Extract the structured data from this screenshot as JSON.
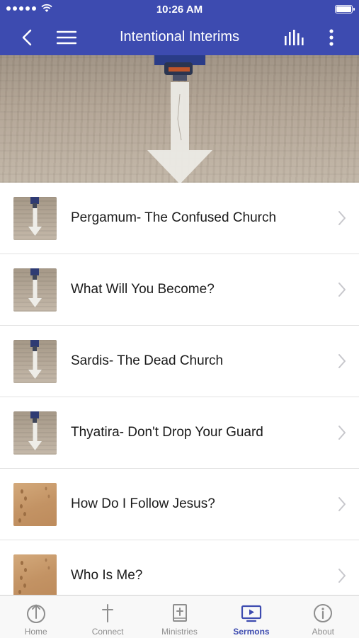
{
  "status_bar": {
    "time": "10:26 AM"
  },
  "header": {
    "title": "Intentional Interims"
  },
  "sermons": [
    {
      "title": "Pergamum- The Confused Church",
      "thumb": "road-arrow"
    },
    {
      "title": "What Will You Become?",
      "thumb": "road-arrow"
    },
    {
      "title": "Sardis- The Dead Church",
      "thumb": "road-arrow"
    },
    {
      "title": "Thyatira- Don't Drop Your Guard",
      "thumb": "road-arrow"
    },
    {
      "title": "How Do I Follow Jesus?",
      "thumb": "footprints-sand"
    },
    {
      "title": "Who Is Me?",
      "thumb": "footprints-sand"
    }
  ],
  "tabs": [
    {
      "label": "Home",
      "icon": "home-arrow-icon"
    },
    {
      "label": "Connect",
      "icon": "cross-icon"
    },
    {
      "label": "Ministries",
      "icon": "bible-icon"
    },
    {
      "label": "Sermons",
      "icon": "video-play-icon",
      "active": true
    },
    {
      "label": "About",
      "icon": "info-icon"
    }
  ],
  "colors": {
    "brand": "#3d4bb0",
    "tab_inactive": "#8e8e8e",
    "chevron": "#c7c7cc"
  }
}
